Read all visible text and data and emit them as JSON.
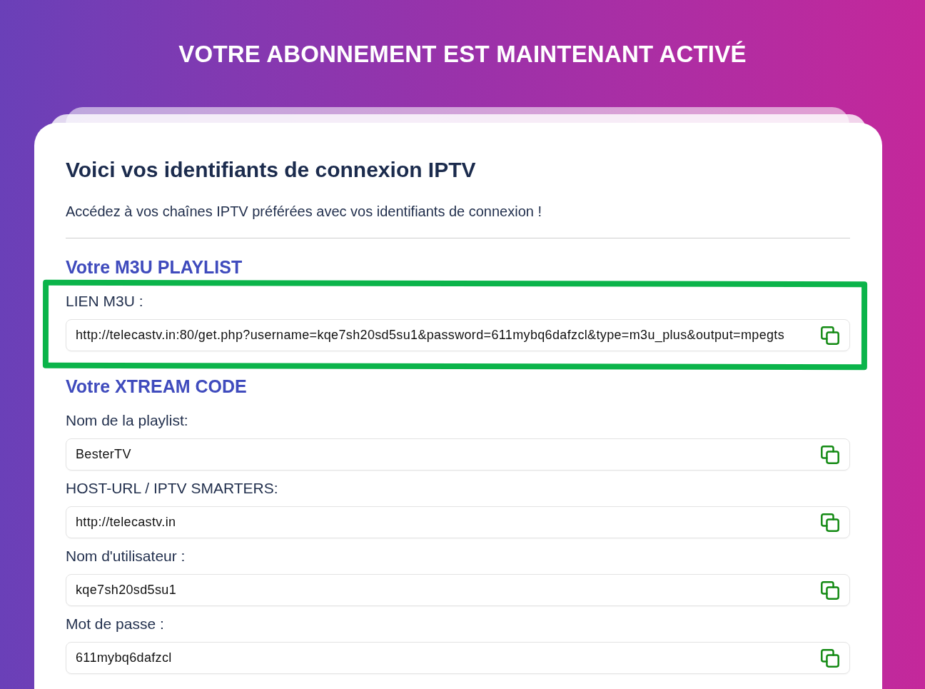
{
  "header": {
    "title": "VOTRE ABONNEMENT EST MAINTENANT ACTIVÉ"
  },
  "card": {
    "title": "Voici vos identifiants de connexion IPTV",
    "intro": "Accédez à vos chaînes IPTV préférées avec vos identifiants de connexion !",
    "sections": [
      {
        "heading": "Votre M3U PLAYLIST",
        "highlighted": true,
        "fields": [
          {
            "label": "LIEN M3U :",
            "value": "http://telecastv.in:80/get.php?username=kqe7sh20sd5su1&password=611mybq6dafzcl&type=m3u_plus&output=mpegts"
          }
        ]
      },
      {
        "heading": "Votre XTREAM CODE",
        "highlighted": false,
        "fields": [
          {
            "label": "Nom de la playlist:",
            "value": "BesterTV"
          },
          {
            "label": "HOST-URL / IPTV SMARTERS:",
            "value": "http://telecastv.in"
          },
          {
            "label": "Nom d'utilisateur :",
            "value": "kqe7sh20sd5su1"
          },
          {
            "label": "Mot de passe :",
            "value": "611mybq6dafzcl"
          }
        ]
      }
    ]
  }
}
